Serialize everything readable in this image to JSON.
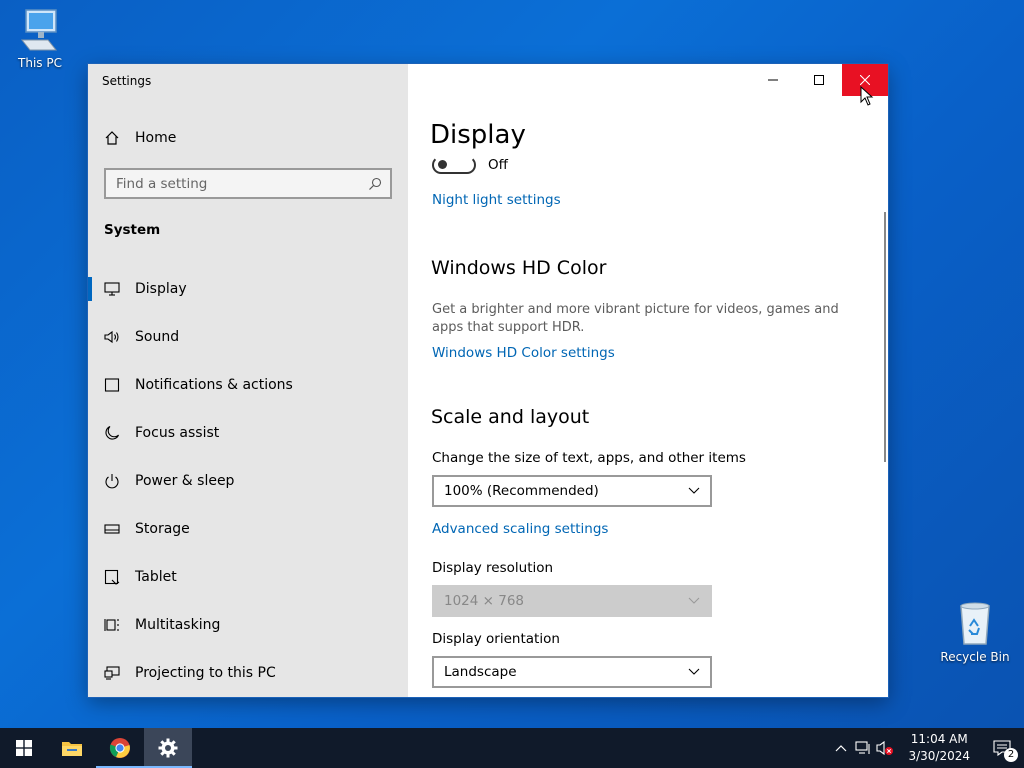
{
  "desktop": {
    "icons": [
      {
        "label": "This PC"
      },
      {
        "label": "Recycle Bin"
      }
    ]
  },
  "window": {
    "title": "Settings",
    "caption": {
      "minimize": "minimize-icon",
      "maximize": "maximize-icon",
      "close": "close-icon"
    }
  },
  "sidebar": {
    "home_label": "Home",
    "search_placeholder": "Find a setting",
    "section": "System",
    "items": [
      {
        "label": "Display",
        "icon": "monitor-icon",
        "active": true
      },
      {
        "label": "Sound",
        "icon": "speaker-icon"
      },
      {
        "label": "Notifications & actions",
        "icon": "notification-icon"
      },
      {
        "label": "Focus assist",
        "icon": "moon-icon"
      },
      {
        "label": "Power & sleep",
        "icon": "power-icon"
      },
      {
        "label": "Storage",
        "icon": "storage-icon"
      },
      {
        "label": "Tablet",
        "icon": "tablet-icon"
      },
      {
        "label": "Multitasking",
        "icon": "multitasking-icon"
      },
      {
        "label": "Projecting to this PC",
        "icon": "projecting-icon"
      }
    ]
  },
  "content": {
    "title": "Display",
    "night_light_state": "Off",
    "night_light_link": "Night light settings",
    "hd_color_heading": "Windows HD Color",
    "hd_color_desc": "Get a brighter and more vibrant picture for videos, games and apps that support HDR.",
    "hd_color_link": "Windows HD Color settings",
    "scale_heading": "Scale and layout",
    "scale_label": "Change the size of text, apps, and other items",
    "scale_value": "100% (Recommended)",
    "advanced_scaling_link": "Advanced scaling settings",
    "resolution_label": "Display resolution",
    "resolution_value": "1024 × 768",
    "orientation_label": "Display orientation",
    "orientation_value": "Landscape"
  },
  "taskbar": {
    "apps": [
      {
        "name": "start-icon"
      },
      {
        "name": "file-explorer-icon"
      },
      {
        "name": "chrome-icon"
      },
      {
        "name": "settings-icon"
      }
    ],
    "time": "11:04 AM",
    "date": "3/30/2024",
    "notification_count": "2"
  },
  "colors": {
    "accent": "#0067c0",
    "link": "#0066b4",
    "close_hover": "#e81123"
  }
}
